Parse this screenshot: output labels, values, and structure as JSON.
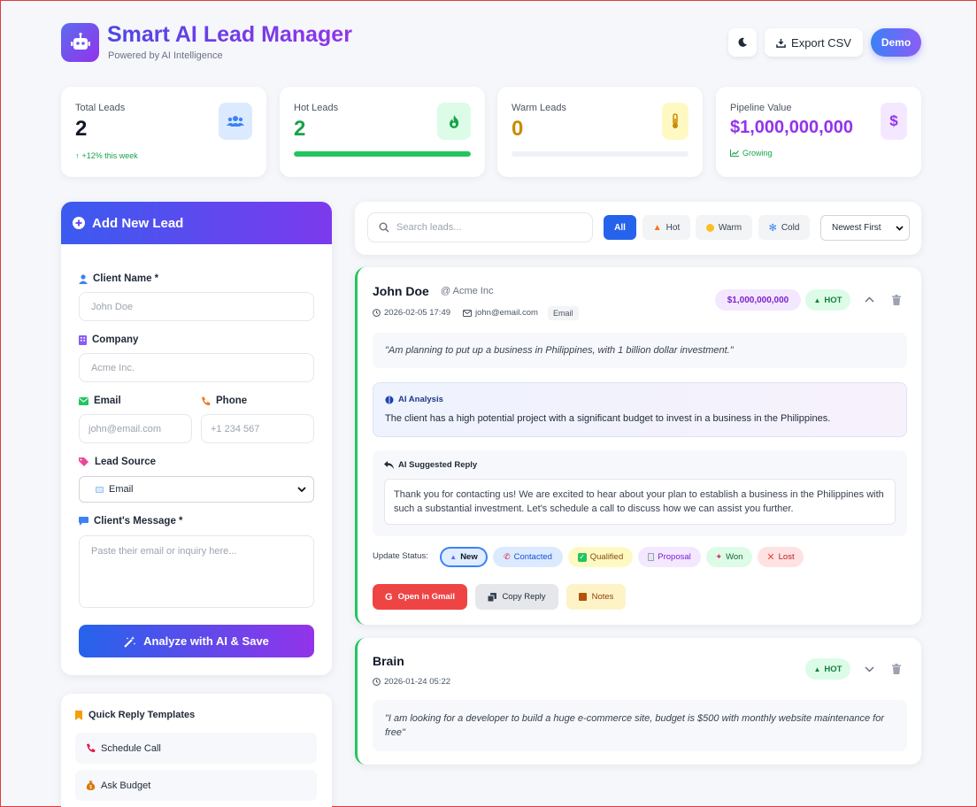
{
  "header": {
    "title": "Smart AI Lead Manager",
    "subtitle": "Powered by AI Intelligence",
    "theme_icon": "moon-icon",
    "export_label": "Export CSV",
    "demo_label": "Demo"
  },
  "stats": {
    "total": {
      "label": "Total Leads",
      "value": "2",
      "trend": "+12% this week"
    },
    "hot": {
      "label": "Hot Leads",
      "value": "2",
      "progress_pct": 100
    },
    "warm": {
      "label": "Warm Leads",
      "value": "0",
      "progress_pct": 0
    },
    "pipeline": {
      "label": "Pipeline Value",
      "value": "$1,000,000,000",
      "trend": "Growing"
    }
  },
  "form": {
    "title": "Add New Lead",
    "client_name_label": "Client Name *",
    "client_name_placeholder": "John Doe",
    "company_label": "Company",
    "company_placeholder": "Acme Inc.",
    "email_label": "Email",
    "email_placeholder": "john@email.com",
    "phone_label": "Phone",
    "phone_placeholder": "+1 234 567",
    "source_label": "Lead Source",
    "source_value": "Email",
    "message_label": "Client's Message *",
    "message_placeholder": "Paste their email or inquiry here...",
    "submit_label": "Analyze with AI & Save"
  },
  "templates": {
    "title": "Quick Reply Templates",
    "items": [
      "Schedule Call",
      "Ask Budget"
    ]
  },
  "filters": {
    "search_placeholder": "Search leads...",
    "chips": [
      "All",
      "Hot",
      "Warm",
      "Cold"
    ],
    "active": "All",
    "sort_value": "Newest First"
  },
  "leads": [
    {
      "name": "John Doe",
      "company": "@ Acme Inc",
      "date": "2026-02-05 17:49",
      "email": "john@email.com",
      "source": "Email",
      "value": "$1,000,000,000",
      "temp": "HOT",
      "message": "\"Am planning to put up a business in Philippines, with 1 billion dollar investment.\"",
      "ai_title": "AI Analysis",
      "ai_text": "The client has a high potential project with a significant budget to invest in a business in the Philippines.",
      "reply_title": "AI Suggested Reply",
      "reply_text": "Thank you for contacting us! We are excited to hear about your plan to establish a business in the Philippines with such a substantial investment. Let's schedule a call to discuss how we can assist you further.",
      "status_label": "Update Status:",
      "statuses": [
        "New",
        "Contacted",
        "Qualified",
        "Proposal",
        "Won",
        "Lost"
      ],
      "active_status": "New",
      "actions": [
        "Open in Gmail",
        "Copy Reply",
        "Notes"
      ]
    },
    {
      "name": "Brain",
      "date": "2026-01-24 05:22",
      "temp": "HOT",
      "message": "\"I am looking for a developer to build a huge e-commerce site, budget is $500 with monthly website maintenance for free\""
    }
  ],
  "colors": {
    "brand_start": "#4f46e5",
    "brand_end": "#9333ea",
    "hot": "#22c55e",
    "warm": "#ca8a04",
    "pipeline": "#9333ea",
    "gmail": "#ef4444"
  }
}
